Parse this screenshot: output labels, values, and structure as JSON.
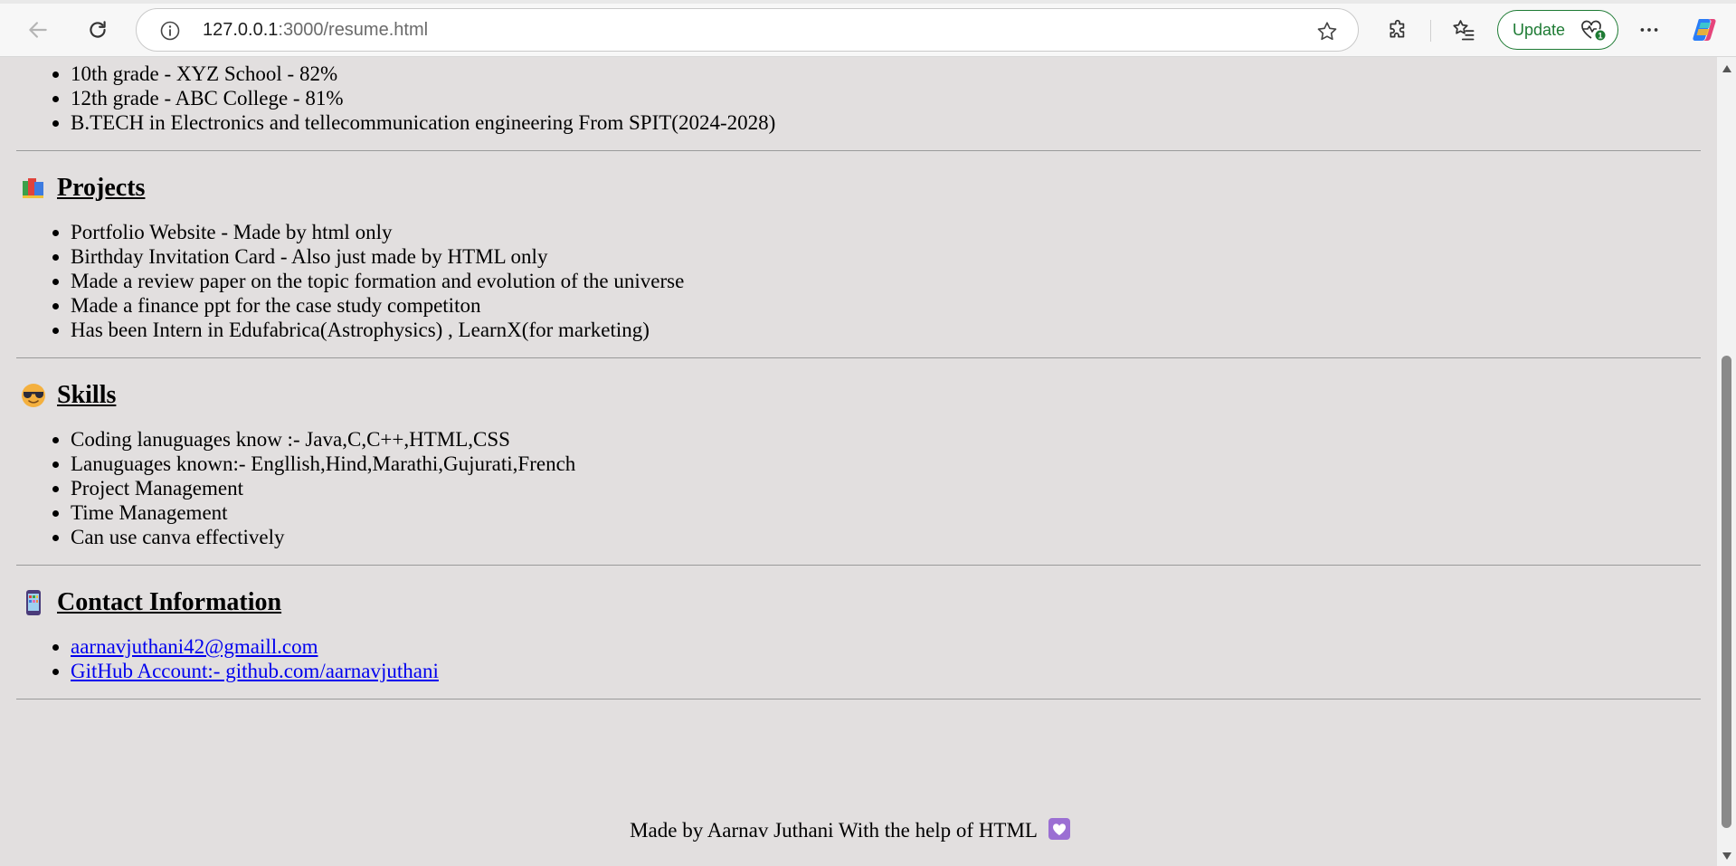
{
  "browser": {
    "url_host": "127.0.0.1",
    "url_path": ":3000/resume.html",
    "update_label": "Update",
    "icons": {
      "back": "back-arrow-icon",
      "reload": "reload-icon",
      "site_info": "info-icon",
      "favorite": "star-icon",
      "extensions": "puzzle-icon",
      "favorites": "favorites-list-icon",
      "update": "heartbeat-icon",
      "more": "ellipsis-icon",
      "copilot": "copilot-icon"
    }
  },
  "education": {
    "items": [
      "10th grade - XYZ School - 82%",
      "12th grade - ABC College - 81%",
      "B.TECH in Electronics and tellecommunication engineering From SPIT(2024-2028)"
    ]
  },
  "projects": {
    "title": "Projects",
    "emoji": "books-emoji",
    "items": [
      "Portfolio Website - Made by html only",
      "Birthday Invitation Card - Also just made by HTML only",
      "Made a review paper on the topic formation and evolution of the universe",
      "Made a finance ppt for the case study competiton",
      "Has been Intern in Edufabrica(Astrophysics) , LearnX(for marketing)"
    ]
  },
  "skills": {
    "title": "Skills",
    "emoji": "sunglasses-emoji",
    "items": [
      "Coding lanuguages know :- Java,C,C++,HTML,CSS",
      "Lanuguages known:- Engllish,Hind,Marathi,Gujurati,French",
      "Project Management",
      "Time Management",
      "Can use canva effectively"
    ]
  },
  "contact": {
    "title": "Contact Information",
    "emoji": "mobile-phone-emoji",
    "email": "aarnavjuthani42@gmaill.com",
    "github": "GitHub Account:- github.com/aarnavjuthani"
  },
  "footer": {
    "text": "Made by Aarnav Juthani With the help of HTML",
    "emoji": "heart-emoji"
  },
  "colors": {
    "page_background": "#e2dfdf",
    "link": "#0000ee",
    "update_accent": "#1e7b34"
  }
}
